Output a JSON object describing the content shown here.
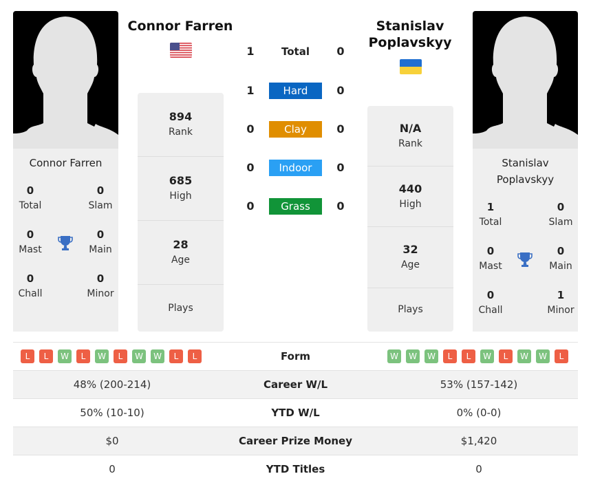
{
  "colors": {
    "hard": "#0a66c2",
    "clay": "#e08e00",
    "indoor": "#2aa0f4",
    "grass": "#119438",
    "win": "#7cc27e",
    "loss": "#ee5f45",
    "trophy": "#3a6fc4"
  },
  "player1": {
    "name": "Connor Farren",
    "flag": "usa-flag-icon",
    "country": "USA",
    "titles": {
      "total": {
        "value": "0",
        "label": "Total"
      },
      "slam": {
        "value": "0",
        "label": "Slam"
      },
      "mast": {
        "value": "0",
        "label": "Mast"
      },
      "main": {
        "value": "0",
        "label": "Main"
      },
      "chall": {
        "value": "0",
        "label": "Chall"
      },
      "minor": {
        "value": "0",
        "label": "Minor"
      }
    },
    "stats": {
      "rank": {
        "value": "894",
        "label": "Rank"
      },
      "high": {
        "value": "685",
        "label": "High"
      },
      "age": {
        "value": "28",
        "label": "Age"
      },
      "plays": {
        "value": "",
        "label": "Plays"
      }
    },
    "form": [
      "L",
      "L",
      "W",
      "L",
      "W",
      "L",
      "W",
      "W",
      "L",
      "L"
    ]
  },
  "player2": {
    "name": "Stanislav Poplavskyy",
    "name_line1": "Stanislav",
    "name_line2": "Poplavskyy",
    "flag": "ukraine-flag-icon",
    "country": "Ukraine",
    "titles": {
      "total": {
        "value": "1",
        "label": "Total"
      },
      "slam": {
        "value": "0",
        "label": "Slam"
      },
      "mast": {
        "value": "0",
        "label": "Mast"
      },
      "main": {
        "value": "0",
        "label": "Main"
      },
      "chall": {
        "value": "0",
        "label": "Chall"
      },
      "minor": {
        "value": "1",
        "label": "Minor"
      }
    },
    "stats": {
      "rank": {
        "value": "N/A",
        "label": "Rank"
      },
      "high": {
        "value": "440",
        "label": "High"
      },
      "age": {
        "value": "32",
        "label": "Age"
      },
      "plays": {
        "value": "",
        "label": "Plays"
      }
    },
    "form": [
      "W",
      "W",
      "W",
      "L",
      "L",
      "W",
      "L",
      "W",
      "W",
      "L"
    ]
  },
  "h2h": [
    {
      "label": "Total",
      "p1": "1",
      "p2": "0"
    },
    {
      "label": "Hard",
      "p1": "1",
      "p2": "0"
    },
    {
      "label": "Clay",
      "p1": "0",
      "p2": "0"
    },
    {
      "label": "Indoor",
      "p1": "0",
      "p2": "0"
    },
    {
      "label": "Grass",
      "p1": "0",
      "p2": "0"
    }
  ],
  "comparison": [
    {
      "label": "Form",
      "p1": "",
      "p2": ""
    },
    {
      "label": "Career W/L",
      "p1": "48% (200-214)",
      "p2": "53% (157-142)"
    },
    {
      "label": "YTD W/L",
      "p1": "50% (10-10)",
      "p2": "0% (0-0)"
    },
    {
      "label": "Career Prize Money",
      "p1": "$0",
      "p2": "$1,420"
    },
    {
      "label": "YTD Titles",
      "p1": "0",
      "p2": "0"
    }
  ]
}
